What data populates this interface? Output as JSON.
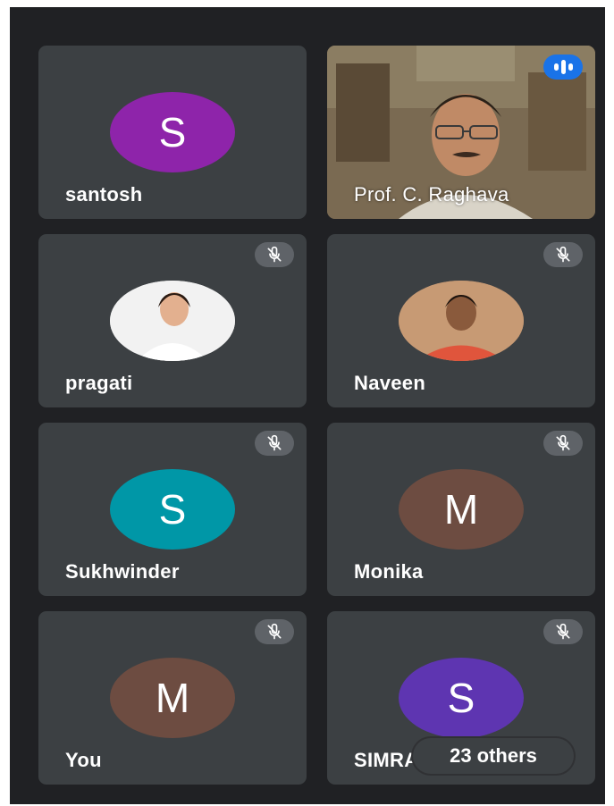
{
  "participants": [
    {
      "name": "santosh",
      "initial": "S",
      "avatar_color": "#8e24aa",
      "muted": false
    },
    {
      "name": "Prof. C. Raghava",
      "video": true,
      "speaking": true
    },
    {
      "name": "pragati",
      "photo": true,
      "muted": true
    },
    {
      "name": "Naveen",
      "photo": true,
      "muted": true
    },
    {
      "name": "Sukhwinder",
      "initial": "S",
      "avatar_color": "#0097a7",
      "muted": true
    },
    {
      "name": "Monika",
      "initial": "M",
      "avatar_color": "#6d4c41",
      "muted": true
    },
    {
      "name": "You",
      "initial": "M",
      "avatar_color": "#6d4c41",
      "muted": true
    },
    {
      "name": "SIMRA",
      "initial": "S",
      "avatar_color": "#5e35b1",
      "muted": true
    }
  ],
  "others_label": "23 others",
  "icons": {
    "mic_off": "mic-off-icon",
    "speaking": "audio-level-icon"
  },
  "colors": {
    "background": "#202124",
    "tile": "#3c4043",
    "mute_badge": "#5f6368",
    "speaking_badge": "#1a73e8"
  }
}
